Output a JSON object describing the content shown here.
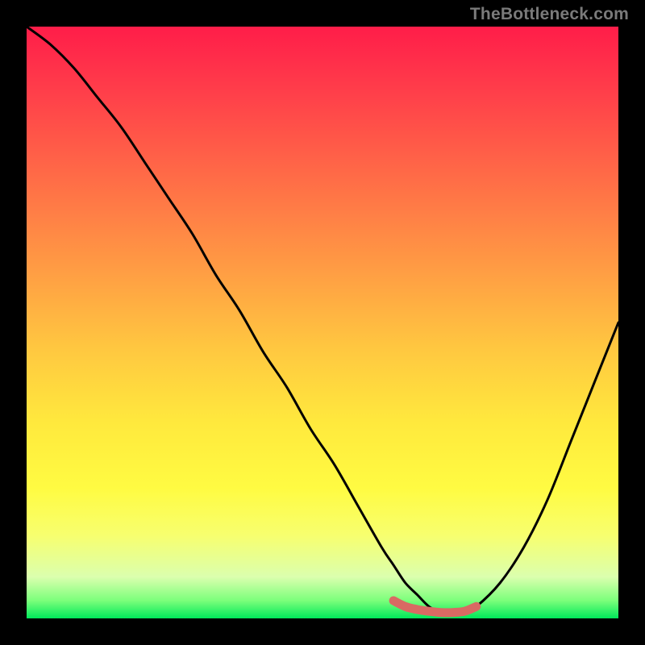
{
  "watermark": "TheBottleneck.com",
  "chart_data": {
    "type": "line",
    "title": "",
    "xlabel": "",
    "ylabel": "",
    "xlim": [
      0,
      100
    ],
    "ylim": [
      0,
      100
    ],
    "series": [
      {
        "name": "bottleneck-curve",
        "x": [
          0,
          4,
          8,
          12,
          16,
          20,
          24,
          28,
          32,
          36,
          40,
          44,
          48,
          52,
          56,
          60,
          62,
          64,
          66,
          68,
          70,
          72,
          74,
          76,
          80,
          84,
          88,
          92,
          96,
          100
        ],
        "y": [
          100,
          97,
          93,
          88,
          83,
          77,
          71,
          65,
          58,
          52,
          45,
          39,
          32,
          26,
          19,
          12,
          9,
          6,
          4,
          2,
          1,
          1,
          1,
          2,
          6,
          12,
          20,
          30,
          40,
          50
        ]
      },
      {
        "name": "sweet-spot-band",
        "x": [
          62,
          64,
          66,
          68,
          70,
          72,
          74,
          76
        ],
        "y": [
          3,
          2,
          1.5,
          1.2,
          1.0,
          1.0,
          1.2,
          2
        ]
      }
    ],
    "colors": {
      "curve": "#000000",
      "band": "#d96a63",
      "gradient_top": "#ff1d49",
      "gradient_mid": "#ffe93d",
      "gradient_bottom": "#00e85a"
    }
  }
}
